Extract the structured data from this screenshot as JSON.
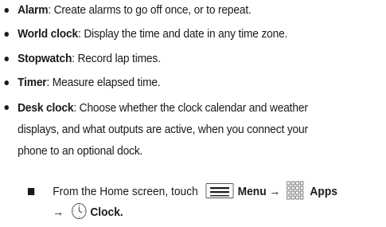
{
  "features": [
    {
      "term": "Alarm",
      "desc": ": Create alarms to go off once, or to repeat."
    },
    {
      "term": "World clock",
      "desc": ": Display the time and date in any time zone."
    },
    {
      "term": "Stopwatch",
      "desc": ": Record lap times."
    },
    {
      "term": "Timer",
      "desc": ": Measure elapsed time."
    },
    {
      "term": "Desk clock",
      "desc_lines": [
        ": Choose whether the clock calendar and weather",
        "displays, and what outputs are active, when you connect your",
        "phone to an optional dock."
      ]
    }
  ],
  "step": {
    "prefix": "From the Home screen, touch",
    "menu_label": "Menu",
    "arrow1": "→",
    "apps_label": "Apps",
    "arrow2": "→",
    "clock_label": "Clock",
    "period": "."
  },
  "icons": {
    "bullet": "bullet-icon",
    "step_marker": "square-bullet-icon",
    "menu": "menu-icon",
    "apps": "apps-grid-icon",
    "clock": "clock-icon"
  },
  "colors": {
    "text": "#1a1a1a",
    "icon_border": "#555555"
  }
}
